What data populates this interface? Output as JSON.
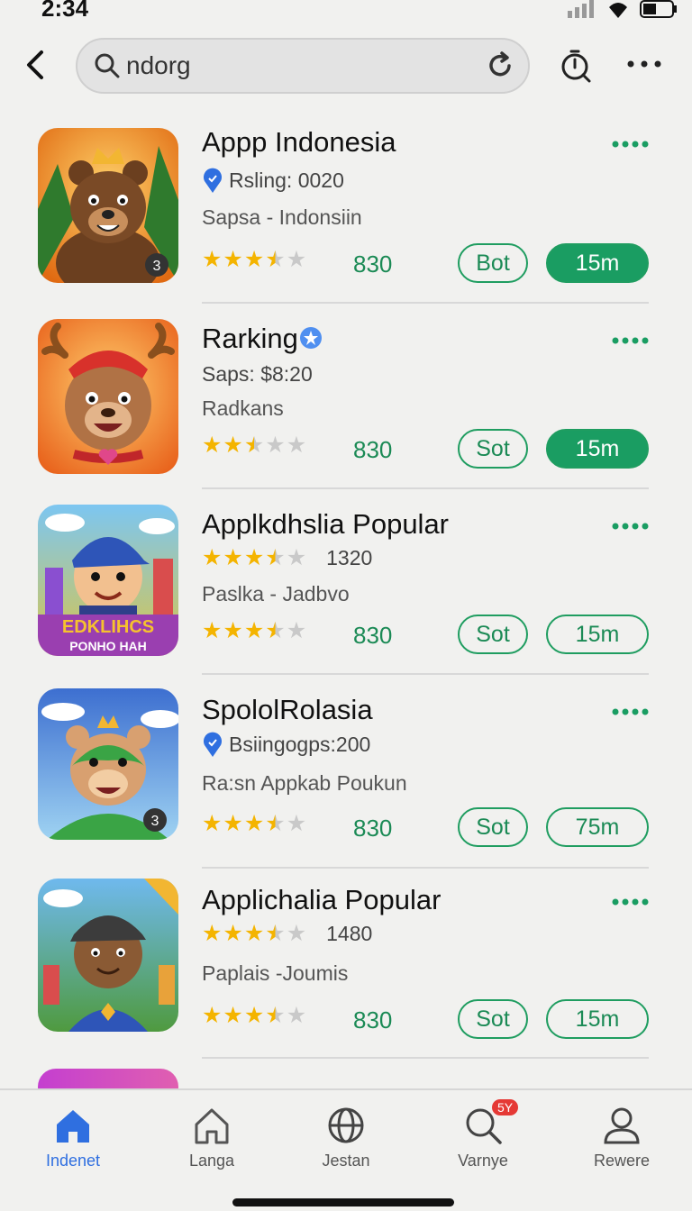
{
  "status_bar": {
    "time": "2:34"
  },
  "search": {
    "query": "ndorg"
  },
  "apps": [
    {
      "title": "Appp Indonesia",
      "line2": "Rsling: 0020",
      "line3": "Sapsa - Indonsiin",
      "rating_stars": 3.5,
      "score": "830",
      "action_label": "Bot",
      "time_label": "15m",
      "time_filled": true,
      "icon_badge": "3",
      "icon_type": "crowned-bear"
    },
    {
      "title": "Rarking",
      "line2": "Saps: $8:20",
      "line3": "Radkans",
      "rating_stars": 2.5,
      "score": "830",
      "action_label": "Sot",
      "time_label": "15m",
      "time_filled": true,
      "icon_badge": "",
      "icon_type": "reindeer"
    },
    {
      "title": "Applkdhslia Popular",
      "line2_count": "1320",
      "line3": "Paslka - Jadbvo",
      "rating_stars": 3.5,
      "score": "830",
      "action_label": "Sot",
      "time_label": "15m",
      "time_filled": false,
      "icon_badge": "",
      "icon_text_top": "EDKLIHCS",
      "icon_text_bottom": "PONHO HAH",
      "icon_type": "cap-boy"
    },
    {
      "title": "SpololRolasia",
      "line2": "Bsiingogps:200",
      "line3": "Ra:sn  Appkab Poukun",
      "rating_stars": 3.5,
      "score": "830",
      "action_label": "Sot",
      "time_label": "75m",
      "time_filled": false,
      "icon_badge": "3",
      "icon_type": "green-bear"
    },
    {
      "title": "Applichalia Popular",
      "line2_count": "1480",
      "line3": "Paplais -Joumis",
      "rating_stars": 3.5,
      "score": "830",
      "action_label": "Sot",
      "time_label": "15m",
      "time_filled": false,
      "icon_badge": "",
      "icon_type": "cap-kid"
    }
  ],
  "bottom_nav": [
    {
      "label": "Indenet",
      "icon": "home-icon",
      "active": true,
      "badge": ""
    },
    {
      "label": "Langa",
      "icon": "house-outline-icon",
      "active": false,
      "badge": ""
    },
    {
      "label": "Jestan",
      "icon": "globe-icon",
      "active": false,
      "badge": ""
    },
    {
      "label": "Varnye",
      "icon": "search-icon",
      "active": false,
      "badge": "5Y"
    },
    {
      "label": "Rewere",
      "icon": "profile-icon",
      "active": false,
      "badge": ""
    }
  ],
  "colors": {
    "accent": "#1a9d62",
    "active_nav": "#2f6fe0",
    "star": "#f4b400"
  }
}
